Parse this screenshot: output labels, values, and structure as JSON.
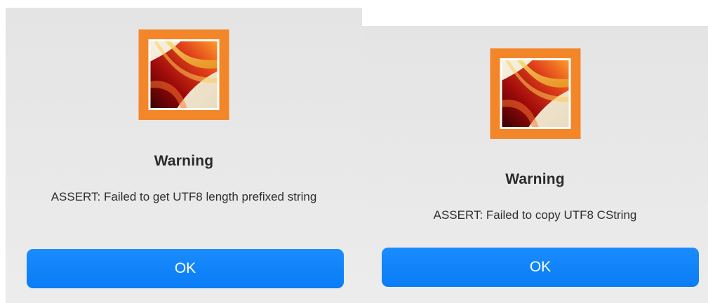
{
  "dialogs": [
    {
      "icon": "app-icon",
      "title": "Warning",
      "message": "ASSERT: Failed to get UTF8 length prefixed string",
      "button_label": "OK"
    },
    {
      "icon": "app-icon",
      "title": "Warning",
      "message": "ASSERT: Failed to copy UTF8 CString",
      "button_label": "OK"
    }
  ],
  "colors": {
    "accent": "#0a7cf5",
    "icon_frame": "#f4862a",
    "dialog_bg": "#e7e7e7"
  }
}
